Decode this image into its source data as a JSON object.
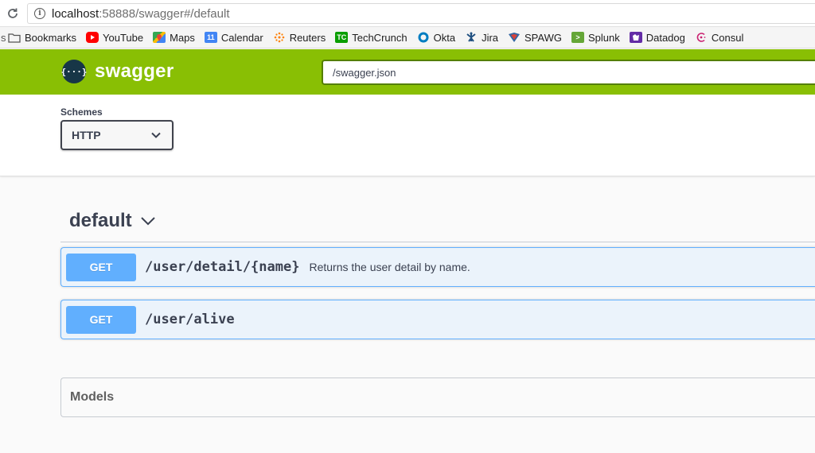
{
  "browser": {
    "url_host": "localhost",
    "url_rest": ":58888/swagger#/default",
    "bookmarks": [
      {
        "label": "Bookmarks",
        "icon": "folder-icon",
        "color": "#6b6b6b"
      },
      {
        "label": "YouTube",
        "icon": "youtube-icon",
        "color": "#ff0000"
      },
      {
        "label": "Maps",
        "icon": "maps-icon",
        "color": "#34a853"
      },
      {
        "label": "Calendar",
        "icon": "calendar-icon",
        "color": "#4285f4"
      },
      {
        "label": "Reuters",
        "icon": "reuters-icon",
        "color": "#ff8000"
      },
      {
        "label": "TechCrunch",
        "icon": "techcrunch-icon",
        "color": "#0a9e01"
      },
      {
        "label": "Okta",
        "icon": "okta-icon",
        "color": "#007dc1"
      },
      {
        "label": "Jira",
        "icon": "jira-icon",
        "color": "#205081"
      },
      {
        "label": "SPAWG",
        "icon": "spawg-icon",
        "color": "#3367a3"
      },
      {
        "label": "Splunk",
        "icon": "splunk-icon",
        "color": "#65a637"
      },
      {
        "label": "Datadog",
        "icon": "datadog-icon",
        "color": "#632ca6"
      },
      {
        "label": "Consul",
        "icon": "consul-icon",
        "color": "#ca2171"
      }
    ],
    "calendar_day": "11"
  },
  "topbar": {
    "logo_mark": "{···}",
    "logo_text": "swagger",
    "spec_url": "/swagger.json",
    "color": "#89bf04"
  },
  "schemes": {
    "label": "Schemes",
    "selected": "HTTP"
  },
  "tag": {
    "name": "default"
  },
  "operations": [
    {
      "method": "GET",
      "path": "/user/detail/{name}",
      "summary": "Returns the user detail by name."
    },
    {
      "method": "GET",
      "path": "/user/alive",
      "summary": ""
    }
  ],
  "models": {
    "title": "Models"
  }
}
